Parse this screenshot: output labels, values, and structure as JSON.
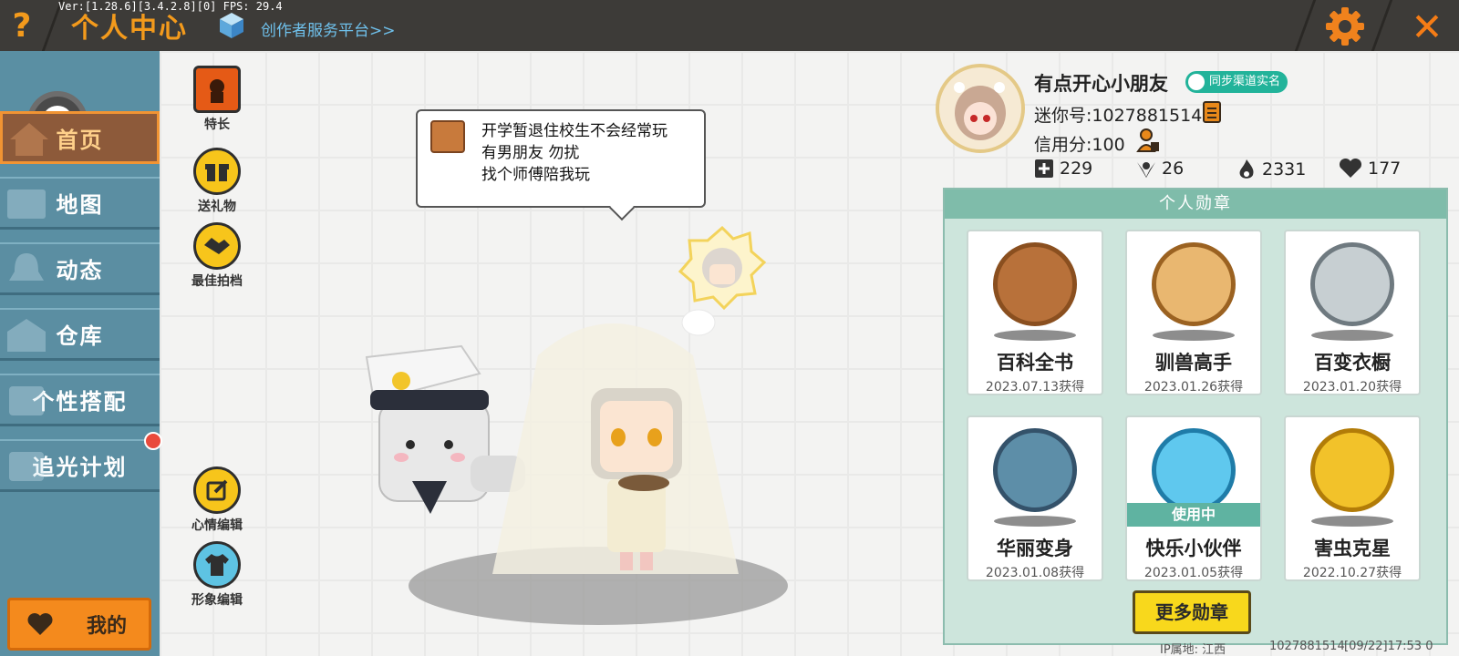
{
  "topbar": {
    "version": "Ver:[1.28.6][3.4.2.8][0] FPS: 29.4",
    "help_icon": "?",
    "title": "个人中心",
    "creator_link": "创作者服务平台>>",
    "settings_icon": "gear-icon",
    "close_icon": "✕"
  },
  "sidebar": {
    "items": [
      {
        "label": "首页",
        "icon": "house-icon",
        "active": true
      },
      {
        "label": "地图",
        "icon": "map-icon",
        "active": false
      },
      {
        "label": "动态",
        "icon": "bell-icon",
        "active": false
      },
      {
        "label": "仓库",
        "icon": "warehouse-icon",
        "active": false
      },
      {
        "label": "个性搭配",
        "icon": "outfit-icon",
        "active": false
      },
      {
        "label": "追光计划",
        "icon": "spotlight-icon",
        "active": false
      }
    ],
    "mine_label": "我的"
  },
  "actions": {
    "specialty": "特长",
    "send_gift": "送礼物",
    "best_partner": "最佳拍档",
    "mood_edit": "心情编辑",
    "avatar_edit": "形象编辑"
  },
  "bubble": {
    "line1": "开学暂退住校生不会经常玩",
    "line2": "有男朋友 勿扰",
    "line3": "找个师傅陪我玩"
  },
  "profile": {
    "nickname": "有点开心小朋友",
    "realname_badge": "同步渠道实名",
    "mini_id": "迷你号:1027881514",
    "credit": "信用分:100",
    "stats": [
      {
        "icon": "add-friend-icon",
        "value": "229"
      },
      {
        "icon": "fans-icon",
        "value": "26"
      },
      {
        "icon": "flame-icon",
        "value": "2331"
      },
      {
        "icon": "heart-icon",
        "value": "177"
      }
    ]
  },
  "badges": {
    "title": "个人勋章",
    "items": [
      {
        "name": "百科全书",
        "date": "2023.07.13获得",
        "color": "#b8713a",
        "in_use": false
      },
      {
        "name": "驯兽高手",
        "date": "2023.01.26获得",
        "color": "#c98a3f",
        "in_use": false
      },
      {
        "name": "百变衣橱",
        "date": "2023.01.20获得",
        "color": "#8e9aa0",
        "in_use": false
      },
      {
        "name": "华丽变身",
        "date": "2023.01.08获得",
        "color": "#4a6e86",
        "in_use": false
      },
      {
        "name": "快乐小伙伴",
        "date": "2023.01.05获得",
        "color": "#37a8d6",
        "in_use": true
      },
      {
        "name": "害虫克星",
        "date": "2022.10.27获得",
        "color": "#d9a316",
        "in_use": false
      }
    ],
    "in_use_label": "使用中",
    "more_label": "更多勋章"
  },
  "footer": {
    "ip": "IP属地: 江西",
    "uid": "1027881514",
    "time": "[09/22]17:53 0"
  },
  "colors": {
    "accent": "#f39a1c",
    "sidebar": "#5b8ea2",
    "badge_panel": "#cde5dc",
    "realname": "#22b39a"
  }
}
